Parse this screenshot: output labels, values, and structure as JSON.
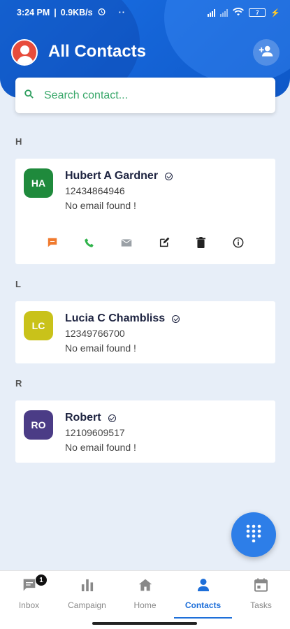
{
  "status_bar": {
    "time": "3:24 PM",
    "speed": "0.9KB/s",
    "battery": "7"
  },
  "header": {
    "title": "All Contacts"
  },
  "search": {
    "placeholder": "Search contact..."
  },
  "contacts": [
    {
      "section": "H",
      "initials": "HA",
      "avatar_color": "#1f8a3c",
      "name": "Hubert A Gardner",
      "phone": "12434864946",
      "email": "No email found !"
    },
    {
      "section": "L",
      "initials": "LC",
      "avatar_color": "#c9c21a",
      "name": "Lucia C Chambliss",
      "phone": "12349766700",
      "email": "No email found !"
    },
    {
      "section": "R",
      "initials": "RO",
      "avatar_color": "#4b3c86",
      "name": "Robert",
      "phone": "12109609517",
      "email": "No email found !"
    }
  ],
  "contact_actions": [
    "sms-icon",
    "phone-icon",
    "mail-icon",
    "edit-icon",
    "delete-icon",
    "info-icon"
  ],
  "bottom_nav": [
    {
      "label": "Inbox",
      "icon": "chat-icon",
      "badge": "1"
    },
    {
      "label": "Campaign",
      "icon": "bar-chart-icon"
    },
    {
      "label": "Home",
      "icon": "home-icon"
    },
    {
      "label": "Contacts",
      "icon": "person-icon",
      "active": true
    },
    {
      "label": "Tasks",
      "icon": "calendar-icon"
    }
  ],
  "colors": {
    "primary": "#1e6fd9",
    "search_text": "#3aa86b",
    "fab": "#2d7ee8"
  }
}
